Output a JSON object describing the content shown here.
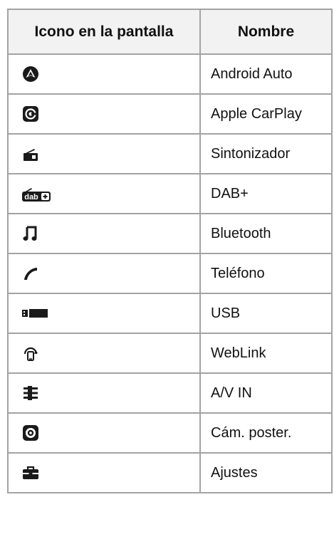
{
  "table": {
    "headers": {
      "icon": "Icono en la pantalla",
      "name": "Nombre"
    },
    "rows": [
      {
        "icon": "android-auto-icon",
        "name": "Android Auto"
      },
      {
        "icon": "apple-carplay-icon",
        "name": "Apple CarPlay"
      },
      {
        "icon": "tuner-radio-icon",
        "name": "Sintonizador"
      },
      {
        "icon": "dab-plus-icon",
        "name": "DAB+",
        "icon_text": "dab"
      },
      {
        "icon": "bluetooth-music-note-icon",
        "name": "Bluetooth"
      },
      {
        "icon": "phone-handset-icon",
        "name": "Teléfono"
      },
      {
        "icon": "usb-drive-icon",
        "name": "USB"
      },
      {
        "icon": "weblink-icon",
        "name": "WebLink"
      },
      {
        "icon": "av-in-cable-icon",
        "name": "A/V IN"
      },
      {
        "icon": "rear-camera-icon",
        "name": "Cám. poster."
      },
      {
        "icon": "settings-toolbox-icon",
        "name": "Ajustes"
      }
    ]
  }
}
